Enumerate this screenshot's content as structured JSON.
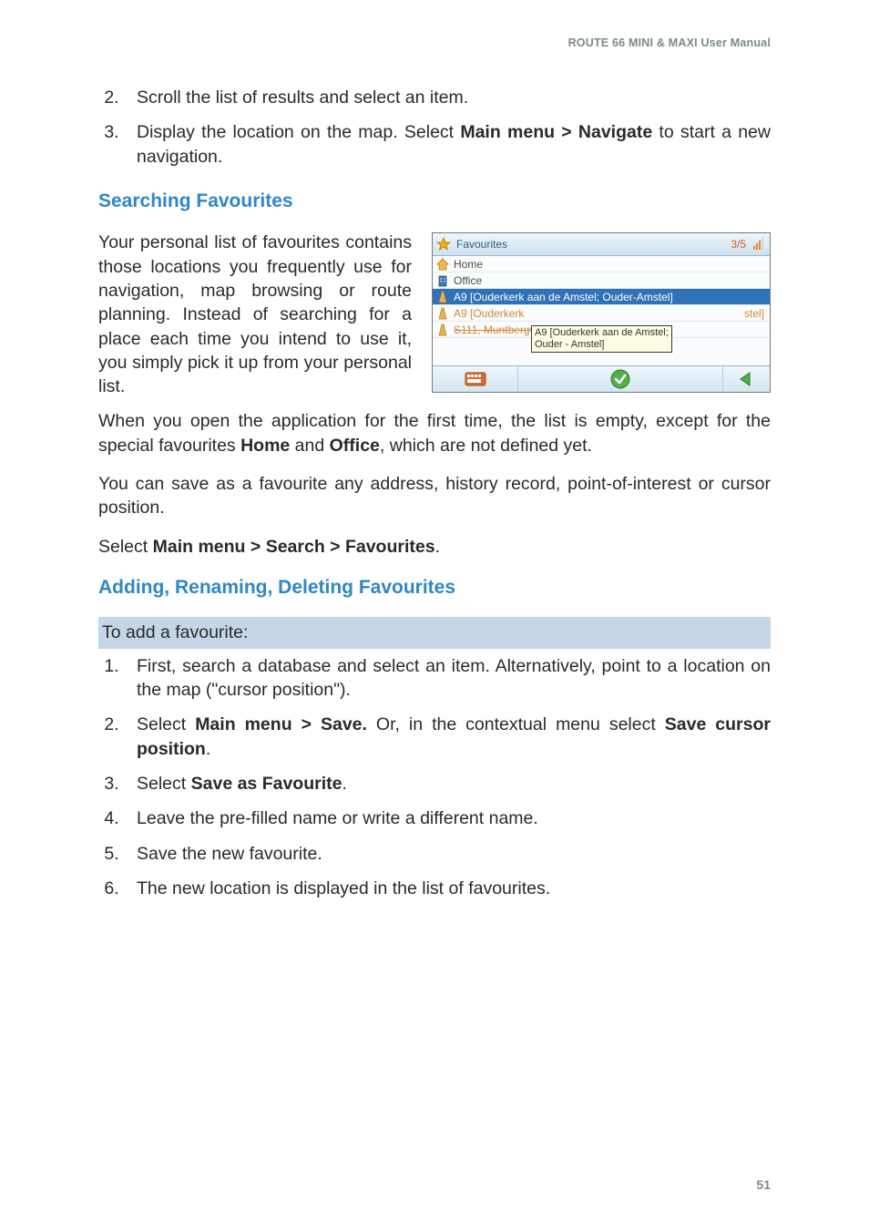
{
  "header": {
    "text": "ROUTE 66 MINI & MAXI User Manual"
  },
  "top_list": {
    "start": 2,
    "items": [
      {
        "pre": "Scroll the list of results and select an item."
      },
      {
        "pre": "Display the location on the map. Select ",
        "bold": "Main menu > Navigate",
        "post": " to start a new navigation."
      }
    ]
  },
  "sec1": {
    "heading": "Searching Favourites",
    "para1": "Your personal list of favourites contains those locations you frequently use for navigation, map browsing or route planning. Instead of searching for a place each time you intend to use it, you simply pick it up from your personal list.",
    "para2_pre": "When you open the application for the first time, the list is empty, except for the special favourites ",
    "para2_b1": "Home",
    "para2_mid": " and ",
    "para2_b2": "Office",
    "para2_post": ", which are not defined yet.",
    "para3": "You can save as a favourite any address, history record, point-of-interest or cursor position.",
    "para4_pre": "Select ",
    "para4_b": "Main menu > Search > Favourites",
    "para4_post": "."
  },
  "sec2": {
    "heading": "Adding, Renaming, Deleting Favourites",
    "subhead": "To add a favourite:",
    "items": [
      {
        "pre": "First, search a database and select an item. Alternatively, point to a location on the map (\"cursor position\")."
      },
      {
        "pre": "Select ",
        "b1": "Main menu > Save.",
        "mid": " Or, in the contextual menu select ",
        "b2": "Save cursor position",
        "post": "."
      },
      {
        "pre": "Select ",
        "b1": "Save as Favourite",
        "post": "."
      },
      {
        "pre": "Leave the pre-filled name or write a different name."
      },
      {
        "pre": "Save the new favourite."
      },
      {
        "pre": "The new location is displayed in the list of favourites."
      }
    ]
  },
  "page_number": "51",
  "screenshot": {
    "title": "Favourites",
    "count": "3/5",
    "rows": {
      "home": "Home",
      "office": "Office",
      "sel": "A9 [Ouderkerk aan de Amstel;  Ouder-Amstel]",
      "r4": "A9 [Ouderkerk ",
      "r5": "S111, Muntbergweg  [Amsterdam-Zuidoost]"
    },
    "tooltip": {
      "l1": "A9 [Ouderkerk aan de Amstel;",
      "l2": "Ouder - Amstel]",
      "tail": "stel]"
    }
  }
}
